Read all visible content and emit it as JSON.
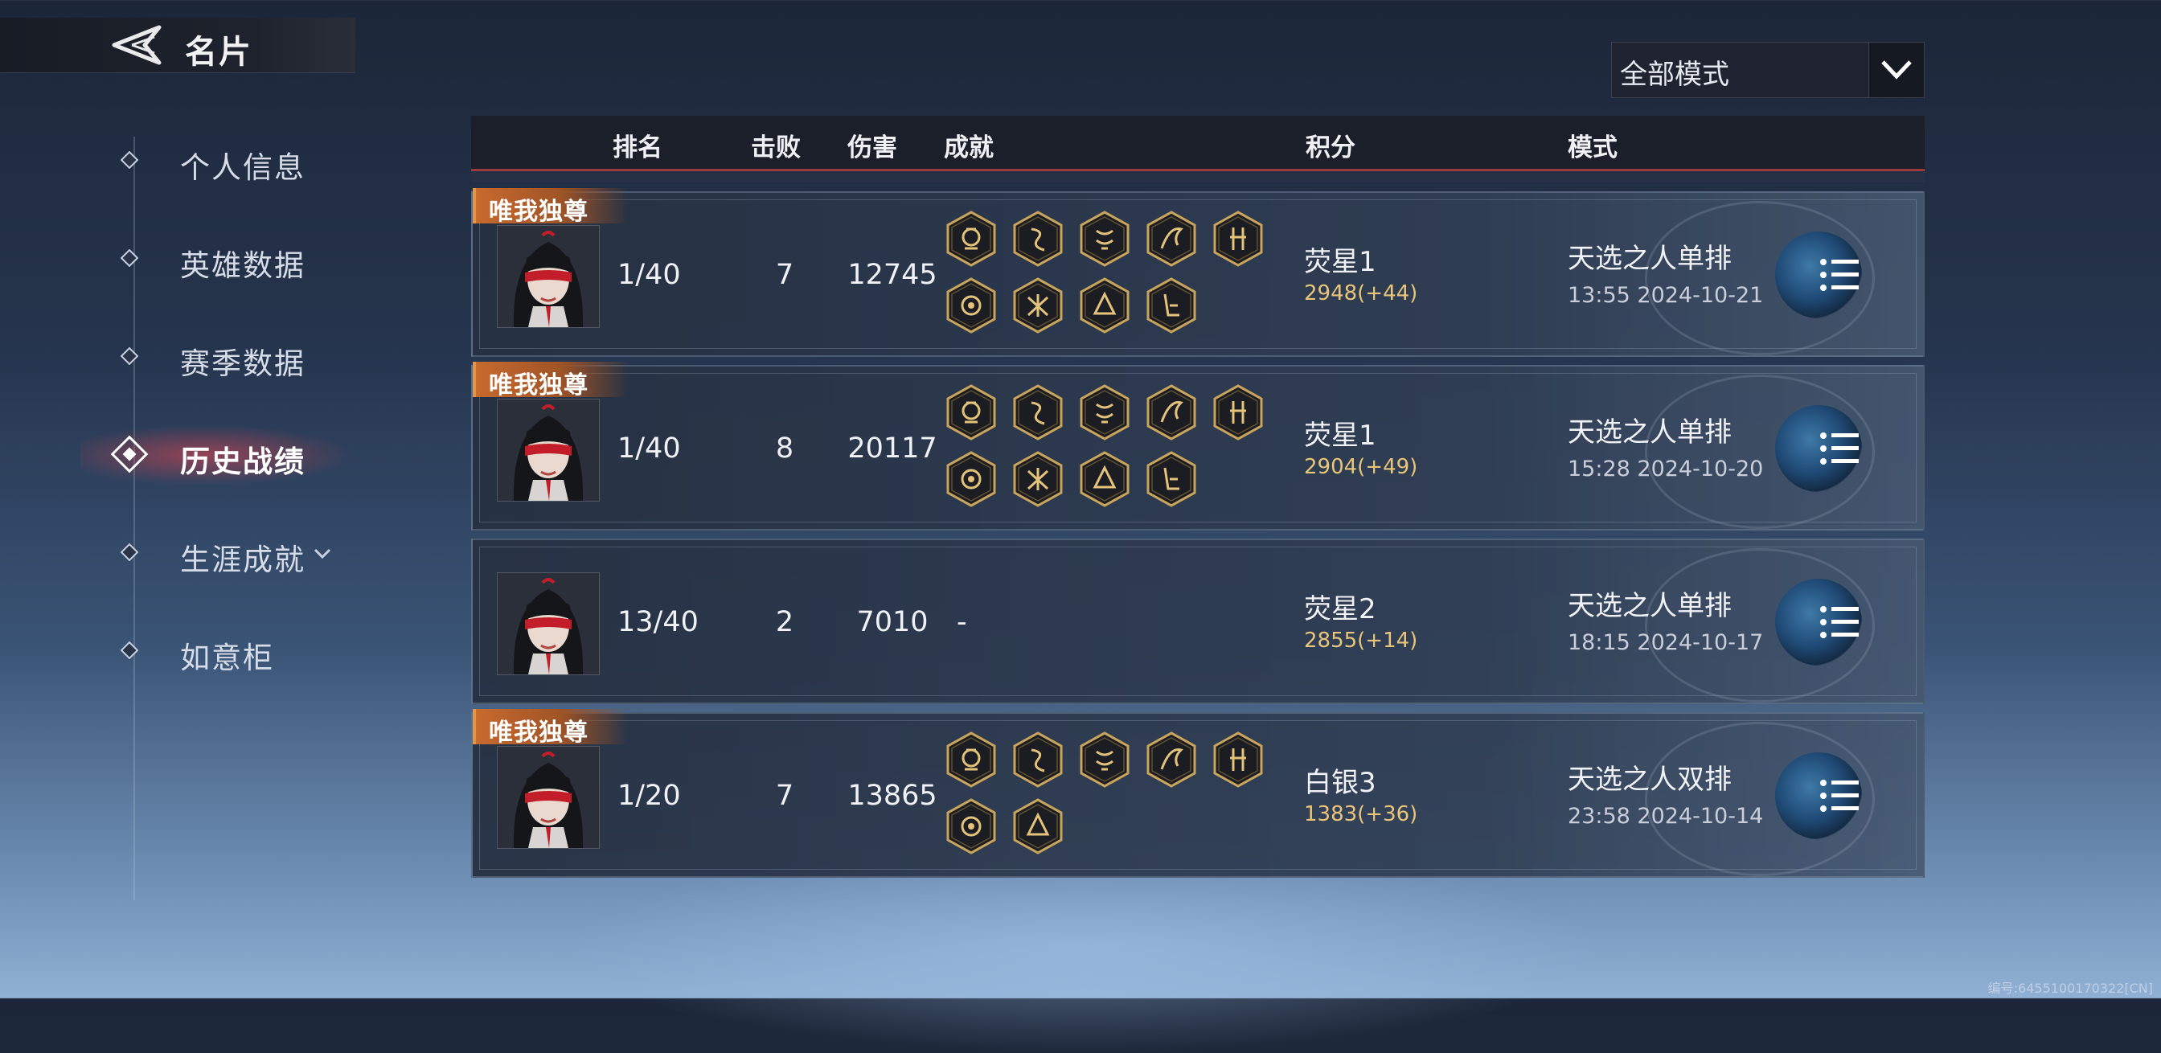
{
  "header": {
    "title": "名片"
  },
  "sidebar": {
    "items": [
      {
        "label": "个人信息",
        "active": false
      },
      {
        "label": "英雄数据",
        "active": false
      },
      {
        "label": "赛季数据",
        "active": false
      },
      {
        "label": "历史战绩",
        "active": true
      },
      {
        "label": "生涯成就",
        "active": false,
        "expandable": true
      },
      {
        "label": "如意柜",
        "active": false
      }
    ]
  },
  "filter": {
    "selected": "全部模式"
  },
  "table": {
    "columns": {
      "rank": "排名",
      "kills": "击败",
      "damage": "伤害",
      "achievements": "成就",
      "score": "积分",
      "mode": "模式"
    },
    "rows": [
      {
        "badge": "唯我独尊",
        "rank": "1/40",
        "kills": "7",
        "damage": "12745",
        "achievement_count": 9,
        "tier": "荧星1",
        "score": "2948(+44)",
        "mode": "天选之人单排",
        "time": "13:55  2024-10-21"
      },
      {
        "badge": "唯我独尊",
        "rank": "1/40",
        "kills": "8",
        "damage": "20117",
        "achievement_count": 9,
        "tier": "荧星1",
        "score": "2904(+49)",
        "mode": "天选之人单排",
        "time": "15:28  2024-10-20"
      },
      {
        "badge": "",
        "rank": "13/40",
        "kills": "2",
        "damage": "7010",
        "achievement_count": 0,
        "no_achievement": "-",
        "tier": "荧星2",
        "score": "2855(+14)",
        "mode": "天选之人单排",
        "time": "18:15  2024-10-17"
      },
      {
        "badge": "唯我独尊",
        "rank": "1/20",
        "kills": "7",
        "damage": "13865",
        "achievement_count": 7,
        "tier": "白银3",
        "score": "1383(+36)",
        "mode": "天选之人双排",
        "time": "23:58  2024-10-14"
      }
    ]
  },
  "footer": {
    "code": "编号:6455100170322[CN]"
  },
  "colors": {
    "accent_red": "#e0464f",
    "score_gold": "#e9c57a",
    "badge_orange": "#c76a2e",
    "achievement_gold": "#d9b56a"
  }
}
